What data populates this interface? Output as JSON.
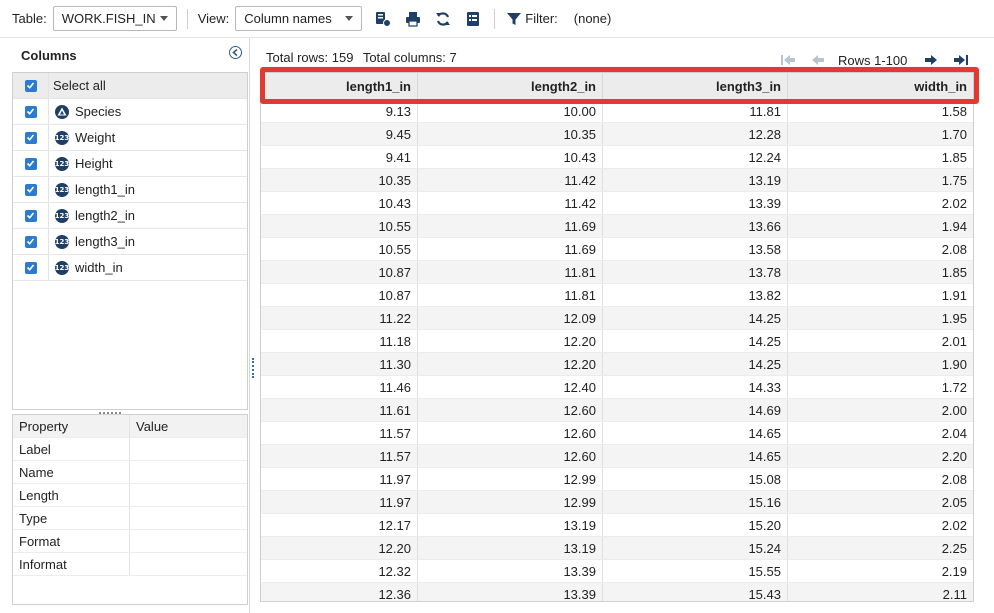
{
  "toolbar": {
    "table_label": "Table:",
    "table_value": "WORK.FISH_IN",
    "view_label": "View:",
    "view_value": "Column names",
    "filter_label": "Filter:",
    "filter_value": "(none)"
  },
  "columns_panel": {
    "title": "Columns",
    "select_all": "Select all",
    "items": [
      {
        "label": "Species",
        "type": "char"
      },
      {
        "label": "Weight",
        "type": "num"
      },
      {
        "label": "Height",
        "type": "num"
      },
      {
        "label": "length1_in",
        "type": "num"
      },
      {
        "label": "length2_in",
        "type": "num"
      },
      {
        "label": "length3_in",
        "type": "num"
      },
      {
        "label": "width_in",
        "type": "num"
      }
    ],
    "badge_num": "123",
    "badge_char": "A"
  },
  "properties": {
    "header": [
      "Property",
      "Value"
    ],
    "rows": [
      "Label",
      "Name",
      "Length",
      "Type",
      "Format",
      "Informat"
    ]
  },
  "data_view": {
    "total_rows": "Total rows: 159",
    "total_columns": "Total columns: 7",
    "rows_range": "Rows 1-100",
    "columns": [
      "length1_in",
      "length2_in",
      "length3_in",
      "width_in"
    ],
    "rows": [
      [
        "9.13",
        "10.00",
        "11.81",
        "1.58"
      ],
      [
        "9.45",
        "10.35",
        "12.28",
        "1.70"
      ],
      [
        "9.41",
        "10.43",
        "12.24",
        "1.85"
      ],
      [
        "10.35",
        "11.42",
        "13.19",
        "1.75"
      ],
      [
        "10.43",
        "11.42",
        "13.39",
        "2.02"
      ],
      [
        "10.55",
        "11.69",
        "13.66",
        "1.94"
      ],
      [
        "10.55",
        "11.69",
        "13.58",
        "2.08"
      ],
      [
        "10.87",
        "11.81",
        "13.78",
        "1.85"
      ],
      [
        "10.87",
        "11.81",
        "13.82",
        "1.91"
      ],
      [
        "11.22",
        "12.09",
        "14.25",
        "1.95"
      ],
      [
        "11.18",
        "12.20",
        "14.25",
        "2.01"
      ],
      [
        "11.30",
        "12.20",
        "14.25",
        "1.90"
      ],
      [
        "11.46",
        "12.40",
        "14.33",
        "1.72"
      ],
      [
        "11.61",
        "12.60",
        "14.69",
        "2.00"
      ],
      [
        "11.57",
        "12.60",
        "14.65",
        "2.04"
      ],
      [
        "11.57",
        "12.60",
        "14.65",
        "2.20"
      ],
      [
        "11.97",
        "12.99",
        "15.08",
        "2.08"
      ],
      [
        "11.97",
        "12.99",
        "15.16",
        "2.05"
      ],
      [
        "12.17",
        "13.19",
        "15.20",
        "2.02"
      ],
      [
        "12.20",
        "13.19",
        "15.24",
        "2.25"
      ],
      [
        "12.32",
        "13.39",
        "15.55",
        "2.19"
      ],
      [
        "12.36",
        "13.39",
        "15.43",
        "2.11"
      ]
    ]
  },
  "colors": {
    "accent": "#2b7bd0",
    "badge": "#1f3f66",
    "highlight": "#e03a32"
  }
}
